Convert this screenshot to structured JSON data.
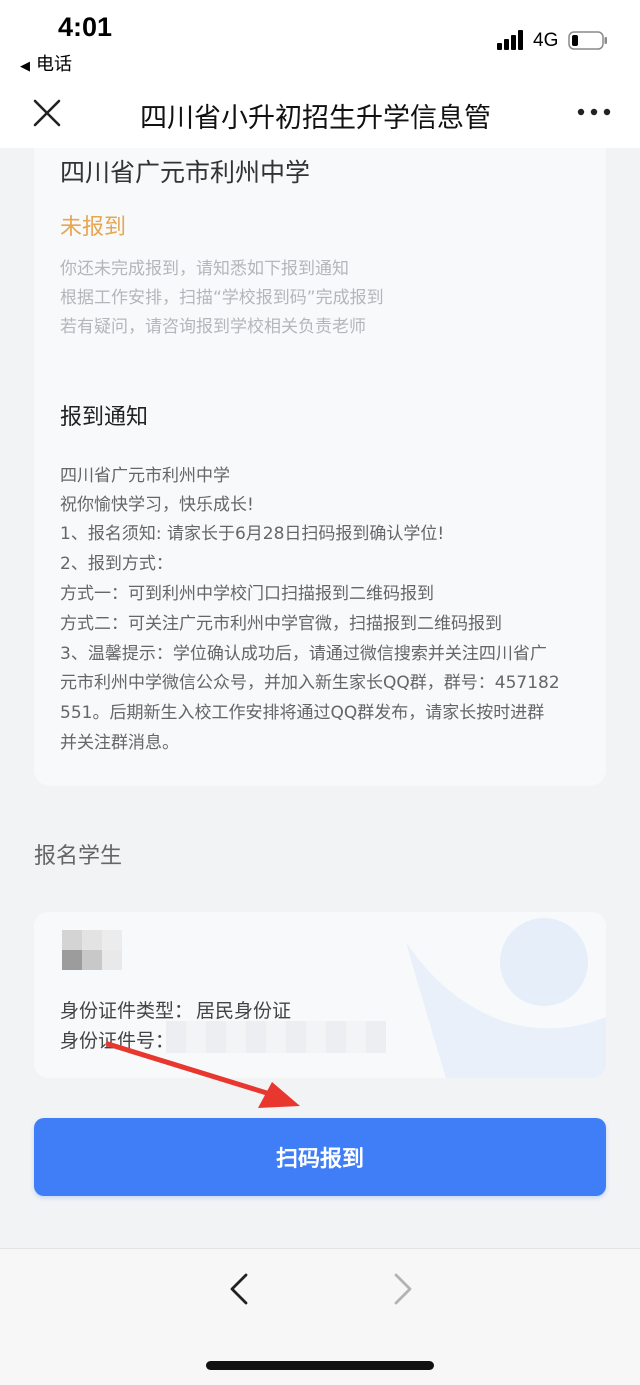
{
  "status_bar": {
    "time": "4:01",
    "back_app": "电话",
    "network": "4G"
  },
  "nav": {
    "title": "四川省小升初招生升学信息管"
  },
  "notice_card": {
    "school_name": "四川省广元市利州中学",
    "status": "未报到",
    "hints": [
      "你还未完成报到，请知悉如下报到通知",
      "根据工作安排，扫描“学校报到码”完成报到",
      "若有疑问，请咨询报到学校相关负责老师"
    ],
    "notice_title": "报到通知",
    "notice_lines": [
      "四川省广元市利州中学",
      "祝你愉快学习，快乐成长!",
      "1、报名须知: 请家长于6月28日扫码报到确认学位!",
      "2、报到方式：",
      "方式一：可到利州中学校门口扫描报到二维码报到",
      "方式二：可关注广元市利州中学官微，扫描报到二维码报到",
      "3、温馨提示：学位确认成功后，请通过微信搜索并关注四川省广",
      "元市利州中学微信公众号，并加入新生家长QQ群，群号：457182",
      "551。后期新生入校工作安排将通过QQ群发布，请家长按时进群",
      "并关注群消息。"
    ]
  },
  "student": {
    "section_label": "报名学生",
    "id_type_label": "身份证件类型：",
    "id_type_value": "居民身份证",
    "id_no_label": "身份证件号："
  },
  "actions": {
    "scan_button": "扫码报到"
  },
  "colors": {
    "accent": "#3f7ef7",
    "status_pending": "#e7a651",
    "arrow": "#e8372f"
  },
  "icons": {
    "close": "close-icon",
    "more": "more-icon",
    "back": "chevron-left-icon",
    "forward": "chevron-right-icon"
  }
}
